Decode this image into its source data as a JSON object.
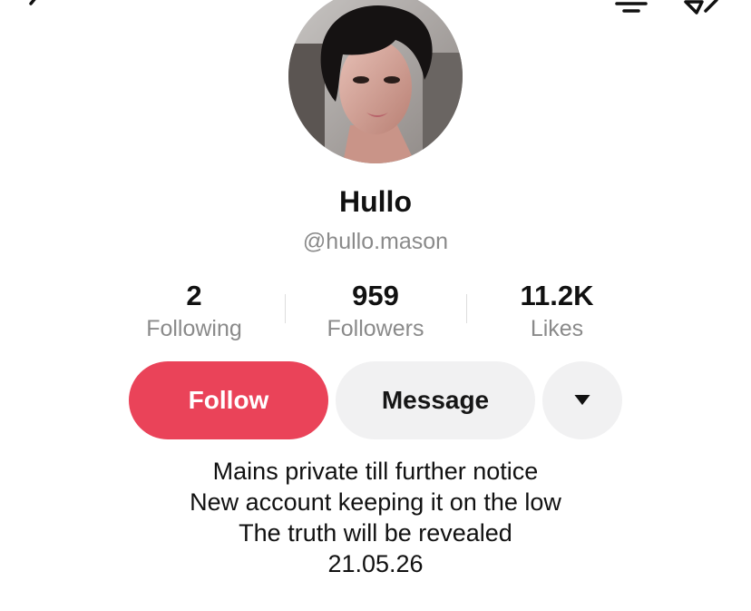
{
  "topbar": {
    "back_icon": "chevron-left-icon",
    "notification_icon": "bell-icon",
    "share_icon": "share-arrow-icon"
  },
  "profile": {
    "display_name": "Hullo",
    "username": "@hullo.mason",
    "avatar_icon": "profile-photo"
  },
  "stats": {
    "following_value": "2",
    "following_label": "Following",
    "followers_value": "959",
    "followers_label": "Followers",
    "likes_value": "11.2K",
    "likes_label": "Likes"
  },
  "actions": {
    "follow_label": "Follow",
    "message_label": "Message",
    "more_icon": "caret-down-icon"
  },
  "bio": {
    "lines": [
      "Mains private till further notice",
      "New account keeping it on the low",
      "The truth will be revealed",
      "21.05.26"
    ]
  },
  "colors": {
    "follow_button_bg": "#ea4359",
    "secondary_button_bg": "#f1f1f2",
    "muted_text": "#8a8a8a"
  }
}
